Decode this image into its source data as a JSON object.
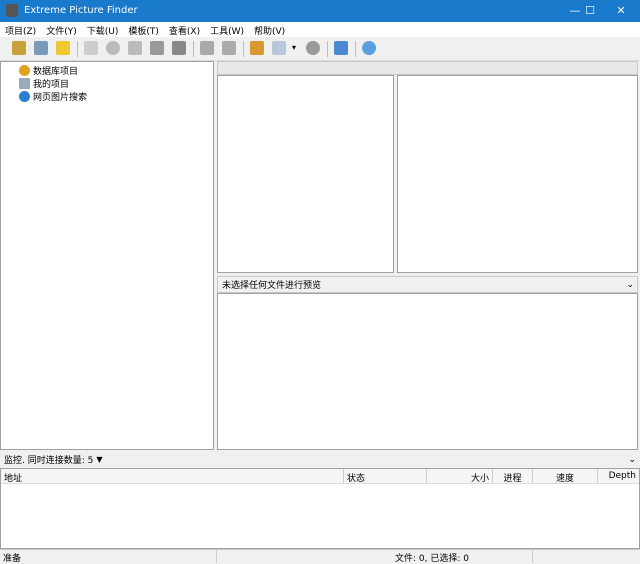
{
  "window": {
    "title": "Extreme Picture Finder",
    "minimize": "—",
    "maximize": "☐",
    "close": "✕"
  },
  "menu": [
    "项目(Z)",
    "文件(Y)",
    "下载(U)",
    "模板(T)",
    "查看(X)",
    "工具(W)",
    "帮助(V)"
  ],
  "toolbar": {
    "buttons": [
      "edit-icon",
      "tools-icon",
      "comment-icon",
      "play-icon",
      "refresh-icon",
      "step-icon",
      "stop-icon",
      "queue-icon",
      "download-icon",
      "upload-icon",
      "palette-icon",
      "view-icon",
      "dropdown-icon",
      "record-icon",
      "image-icon",
      "help-icon"
    ]
  },
  "tree": {
    "items": [
      {
        "label": "数据库项目",
        "icon": "database-icon",
        "color": "#e0a020"
      },
      {
        "label": "我的项目",
        "icon": "folder-icon",
        "color": "#9ab"
      },
      {
        "label": "网页图片搜索",
        "icon": "globe-icon",
        "color": "#2a7fd4"
      }
    ]
  },
  "preview": {
    "label": "未选择任何文件进行预览"
  },
  "monitor": {
    "label": "监控. 同时连接数量: 5"
  },
  "table": {
    "columns": [
      "地址",
      "状态",
      "大小",
      "进程",
      "速度",
      "Depth"
    ]
  },
  "status": {
    "left": "准备",
    "files": "文件: 0, 已选择: 0"
  },
  "colors": {
    "titlebar": "#1979ca"
  }
}
